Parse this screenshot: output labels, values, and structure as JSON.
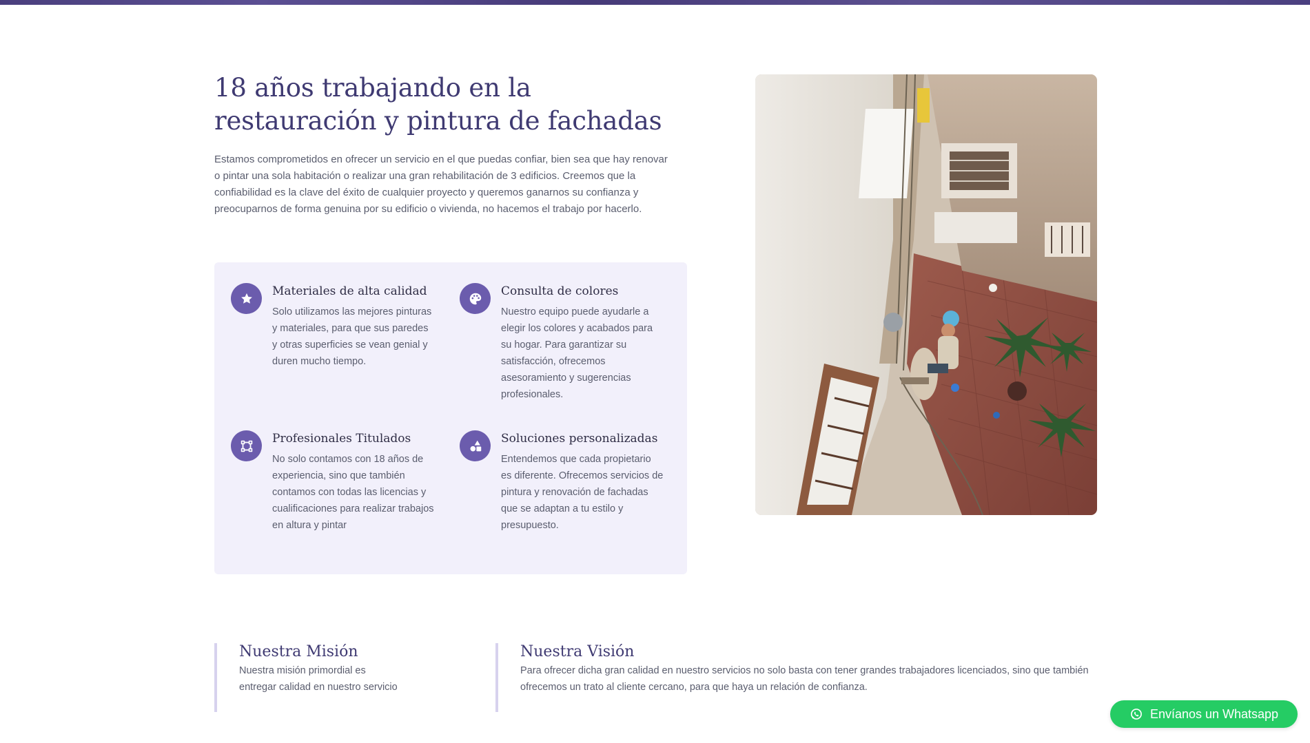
{
  "colors": {
    "heading": "#3f3a72",
    "accent": "#6b5cad",
    "feature_bg": "#f2f0fb",
    "whatsapp_green": "#25cc64",
    "body_text": "#5a5d6e"
  },
  "about": {
    "heading": "18 años trabajando en la restauración y pintura de fachadas",
    "intro": "Estamos comprometidos en ofrecer un servicio en el que puedas confiar, bien sea que hay renovar o pintar una sola habitación o realizar una gran rehabilitación de 3 edificios. Creemos que la confiabilidad es la clave del éxito de cualquier proyecto y queremos ganarnos su confianza y preocuparnos de forma genuina por su edificio o vivienda, no hacemos el trabajo por hacerlo."
  },
  "features": [
    {
      "icon": "star-icon",
      "title": "Materiales de alta calidad",
      "text": "Solo utilizamos las mejores pinturas y materiales, para que sus paredes y otras superficies se vean genial y duren mucho tiempo."
    },
    {
      "icon": "palette-icon",
      "title": "Consulta de colores",
      "text": "Nuestro equipo puede ayudarle a elegir los colores y acabados para su hogar. Para garantizar su satisfacción, ofrecemos asesoramiento y sugerencias profesionales."
    },
    {
      "icon": "vector-square-icon",
      "title": "Profesionales Titulados",
      "text": "No solo contamos con 18 años de experiencia, sino que también contamos con todas las licencias y cualificaciones para realizar trabajos en altura y pintar"
    },
    {
      "icon": "shapes-icon",
      "title": "Soluciones personalizadas",
      "text": "Entendemos que cada propietario es diferente. Ofrecemos servicios de pintura y renovación de fachadas que se adaptan a tu estilo y presupuesto."
    }
  ],
  "mission": {
    "title": "Nuestra Misión",
    "text": "Nuestra misión primordial es entregar calidad en nuestro servicio"
  },
  "vision": {
    "title": "Nuestra Visión",
    "text": "Para ofrecer dicha gran calidad en nuestro servicios no solo basta con tener grandes trabajadores licenciados, sino que también ofrecemos un trato al cliente cercano, para que haya un relación de confianza."
  },
  "whatsapp": {
    "label": "Envíanos un Whatsapp",
    "icon": "whatsapp-icon"
  }
}
